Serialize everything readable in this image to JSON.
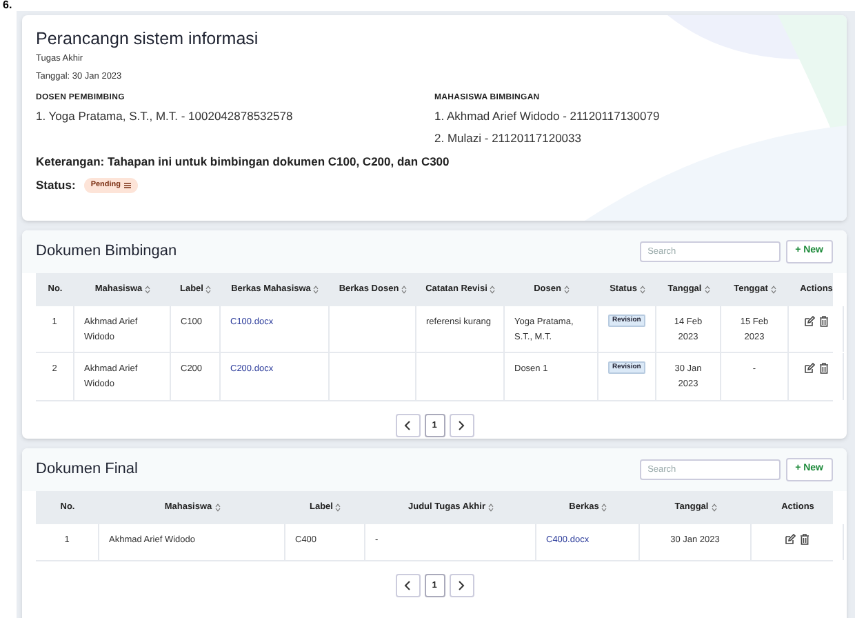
{
  "page_fragment": "6.",
  "project": {
    "title": "Perancangn sistem informasi",
    "type": "Tugas Akhir",
    "date": "Tanggal: 30 Jan 2023",
    "dosen_heading": "DOSEN PEMBIMBING",
    "dosen": [
      "1. Yoga Pratama, S.T., M.T. - 1002042878532578"
    ],
    "mahasiswa_heading": "MAHASISWA BIMBINGAN",
    "mahasiswa": [
      "1. Akhmad Arief Widodo - 21120117130079",
      "2. Mulazi - 21120117120033"
    ],
    "keterangan": "Keterangan: Tahapan ini untuk bimbingan dokumen C100, C200, dan C300",
    "status_label": "Status:",
    "status": "Pending"
  },
  "tables": [
    {
      "title": "Dokumen Bimbingan",
      "search": {
        "placeholder": "Search"
      },
      "new_button": "+ New",
      "columns": [
        {
          "label": "No.",
          "kind": "text",
          "sortable": false
        },
        {
          "label": "Mahasiswa",
          "kind": "text",
          "sortable": true
        },
        {
          "label": "Label",
          "kind": "text",
          "sortable": true
        },
        {
          "label": "Berkas Mahasiswa",
          "kind": "link",
          "sortable": true
        },
        {
          "label": "Berkas Dosen",
          "kind": "link",
          "sortable": true
        },
        {
          "label": "Catatan Revisi",
          "kind": "text",
          "sortable": true
        },
        {
          "label": "Dosen",
          "kind": "text",
          "sortable": true
        },
        {
          "label": "Status",
          "kind": "badge",
          "sortable": true
        },
        {
          "label": "Tanggal",
          "kind": "text",
          "sortable": true
        },
        {
          "label": "Tenggat",
          "kind": "text",
          "sortable": true
        },
        {
          "label": "Actions",
          "kind": "actions",
          "sortable": false
        }
      ],
      "rows": [
        {
          "cells": [
            "1",
            "Akhmad Arief Widodo",
            "C100",
            "C100.docx",
            null,
            "referensi kurang",
            "Yoga Pratama, S.T., M.T.",
            "Revision",
            "14 Feb 2023",
            "15 Feb 2023",
            null
          ]
        },
        {
          "cells": [
            "2",
            "Akhmad Arief Widodo",
            "C200",
            "C200.docx",
            null,
            null,
            "Dosen 1",
            "Revision",
            "30 Jan 2023",
            "-",
            null
          ]
        }
      ],
      "pages": [
        {
          "label": "1",
          "selected": true
        }
      ]
    },
    {
      "title": "Dokumen Final",
      "search": {
        "placeholder": "Search"
      },
      "new_button": "+ New",
      "columns": [
        {
          "label": "No.",
          "kind": "text",
          "sortable": false
        },
        {
          "label": "Mahasiswa",
          "kind": "text",
          "sortable": true
        },
        {
          "label": "Label",
          "kind": "text",
          "sortable": true
        },
        {
          "label": "Judul Tugas Akhir",
          "kind": "text",
          "sortable": true
        },
        {
          "label": "Berkas",
          "kind": "link",
          "sortable": true
        },
        {
          "label": "Tanggal",
          "kind": "text",
          "sortable": true
        },
        {
          "label": "Actions",
          "kind": "actions",
          "sortable": false
        }
      ],
      "rows": [
        {
          "cells": [
            "1",
            "Akhmad Arief Widodo",
            "C400",
            "-",
            "C400.docx",
            "30 Jan 2023",
            null
          ]
        }
      ],
      "pages": [
        {
          "label": "1",
          "selected": true
        }
      ]
    }
  ]
}
